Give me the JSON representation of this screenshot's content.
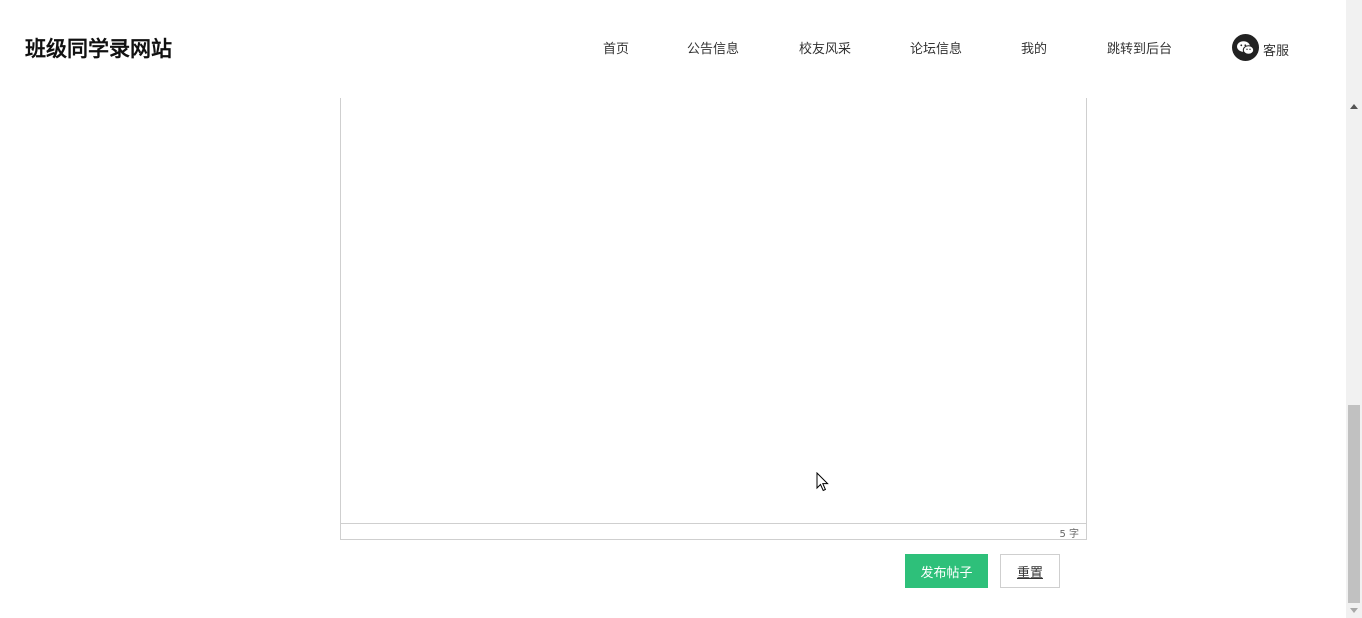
{
  "header": {
    "logo": "班级同学录网站",
    "nav": [
      {
        "label": "首页"
      },
      {
        "label": "公告信息"
      },
      {
        "label": "校友风采"
      },
      {
        "label": "论坛信息"
      },
      {
        "label": "我的"
      },
      {
        "label": "跳转到后台"
      }
    ],
    "service": {
      "label": "客服",
      "icon": "wechat-icon"
    }
  },
  "editor": {
    "word_count": "5 字"
  },
  "actions": {
    "publish_label": "发布帖子",
    "reset_label": "重置"
  },
  "colors": {
    "primary": "#2ec07a",
    "border": "#cfcfcf"
  }
}
